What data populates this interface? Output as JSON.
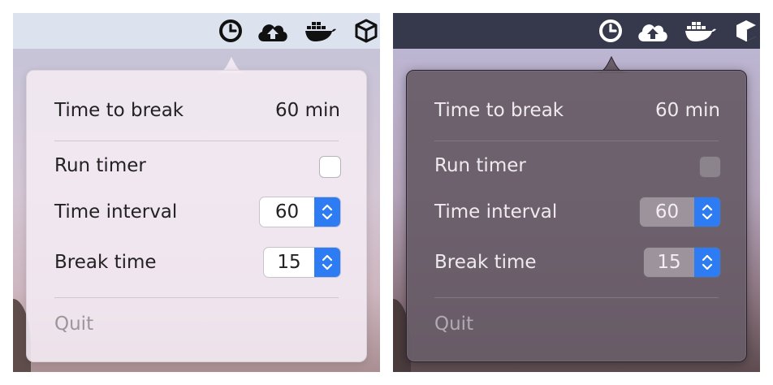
{
  "variants": [
    {
      "theme": "light",
      "time_to_break_label": "Time to break",
      "time_to_break_value": "60 min",
      "run_timer_label": "Run timer",
      "run_timer_checked": false,
      "time_interval_label": "Time interval",
      "time_interval_value": "60",
      "break_time_label": "Break time",
      "break_time_value": "15",
      "quit_label": "Quit"
    },
    {
      "theme": "dark",
      "time_to_break_label": "Time to break",
      "time_to_break_value": "60 min",
      "run_timer_label": "Run timer",
      "run_timer_checked": false,
      "time_interval_label": "Time interval",
      "time_interval_value": "60",
      "break_time_label": "Break time",
      "break_time_value": "15",
      "quit_label": "Quit"
    }
  ],
  "menubar_icons": [
    "clock-icon",
    "cloud-upload-icon",
    "docker-icon",
    "box-icon"
  ],
  "colors": {
    "accent": "#2d7cf3",
    "light_menubar": "#dde3ee",
    "dark_menubar": "#36394c"
  }
}
